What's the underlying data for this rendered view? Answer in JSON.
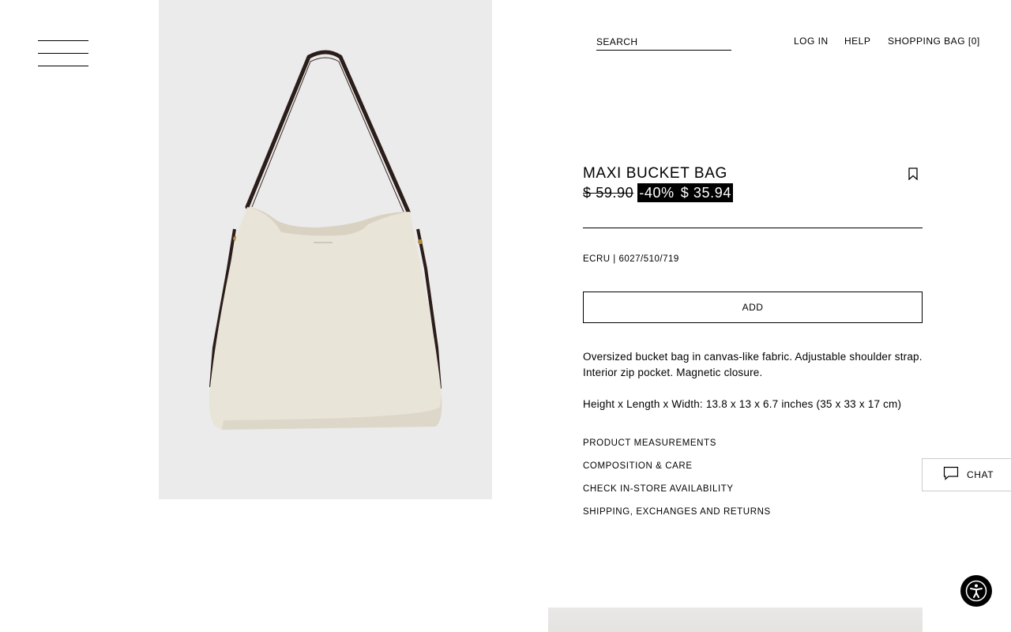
{
  "header": {
    "menu_icon": "hamburger-menu-icon",
    "search_placeholder": "SEARCH",
    "login_label": "LOG IN",
    "help_label": "HELP",
    "bag_label": "SHOPPING BAG [0]"
  },
  "product": {
    "image_alt": "Maxi bucket bag in ecru canvas",
    "title": "MAXI BUCKET BAG",
    "old_price": "$ 59.90",
    "discount": "-40%",
    "sale_price": "$ 35.94",
    "color_ref": "ECRU | 6027/510/719",
    "add_label": "ADD",
    "description": "Oversized bucket bag in canvas-like fabric. Adjustable shoulder strap. Interior zip pocket. Magnetic closure.",
    "dimensions": "Height x Length x Width: 13.8 x 13 x 6.7 inches (35 x 33 x 17 cm)",
    "bookmark_icon": "bookmark-icon",
    "links": [
      "PRODUCT MEASUREMENTS",
      "COMPOSITION & CARE",
      "CHECK IN-STORE AVAILABILITY",
      "SHIPPING, EXCHANGES AND RETURNS"
    ]
  },
  "chat": {
    "label": "CHAT",
    "icon": "chat-bubble-icon"
  },
  "accessibility": {
    "icon": "accessibility-icon"
  },
  "colors": {
    "text": "#000000",
    "background": "#ffffff",
    "image_bg": "#ebebeb",
    "bag_canvas": "#e9e4d8",
    "strap": "#2b1d1a"
  }
}
